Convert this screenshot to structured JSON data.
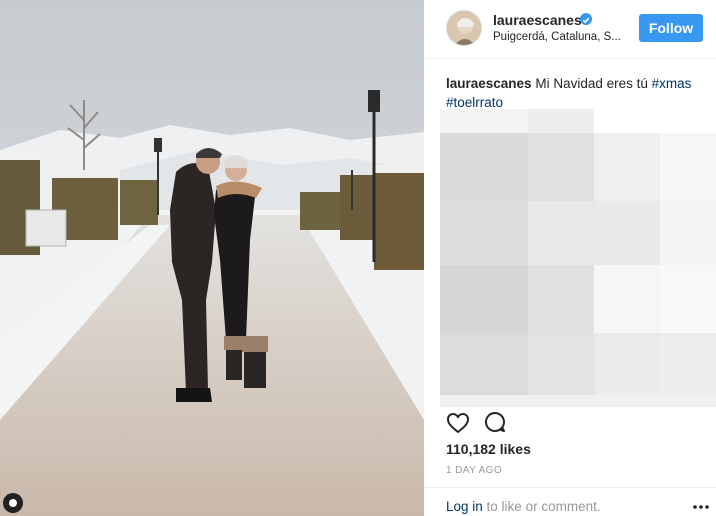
{
  "post": {
    "username": "lauraescanes",
    "verified_icon": "verified-badge-icon",
    "location": "Puigcerdá, Cataluna, S...",
    "follow_label": "Follow",
    "caption_user": "lauraescanes",
    "caption_text": "Mi Navidad eres tú",
    "hashtag_1": "#xmas",
    "hashtag_2": "#toelrrato",
    "likes": "110,182 likes",
    "time_ago": "1 DAY AGO",
    "login_link": "Log in",
    "login_suffix": " to like or comment."
  },
  "icons": {
    "like": "heart-icon",
    "comment": "comment-icon",
    "more": "more-options-icon",
    "photo_corner": "camera-icon"
  },
  "colors": {
    "accent": "#3897f0",
    "hashtag": "#003569",
    "muted": "#999999"
  }
}
